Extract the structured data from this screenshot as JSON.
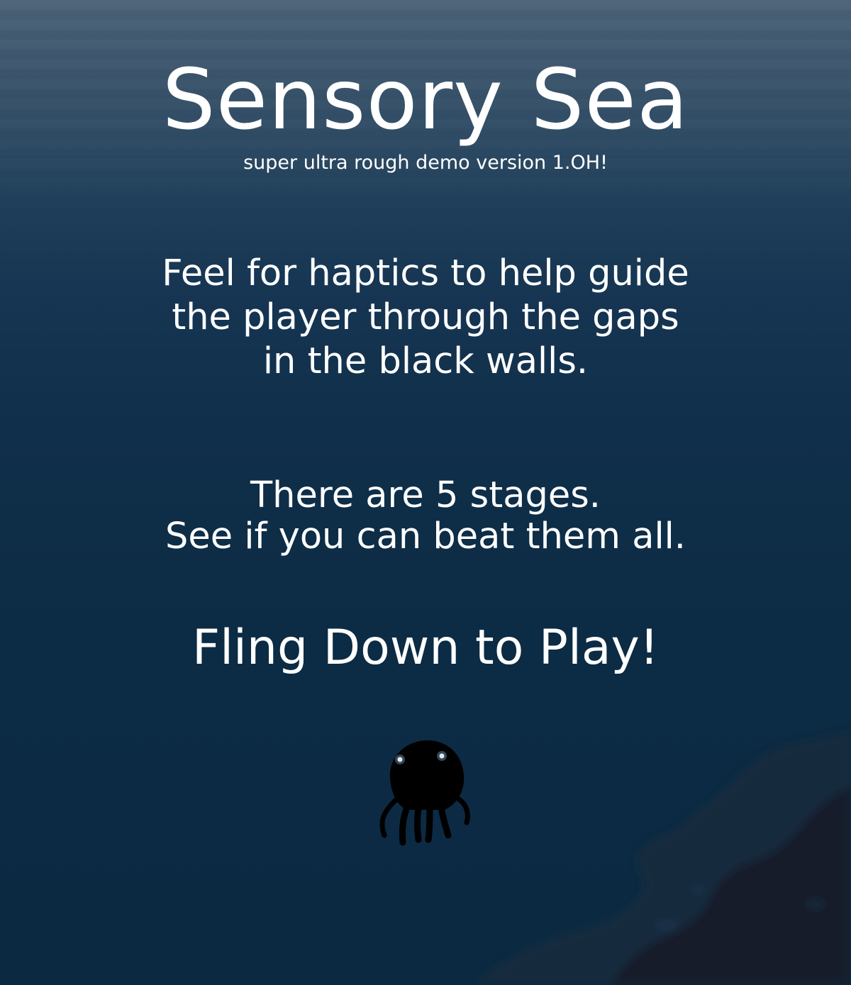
{
  "game": {
    "title": "Sensory Sea",
    "subtitle": "super ultra rough demo version 1.OH!",
    "instructions": [
      "Feel for haptics to help guide",
      "the player through the gaps",
      "in the black walls."
    ],
    "stages_info": [
      "There are 5 stages.",
      "See if you can beat them all."
    ],
    "play_prompt": "Fling Down to Play!",
    "stage_count": 5
  },
  "colors": {
    "sky_top": "#4a6176",
    "sea_deep": "#0b2a42",
    "text": "#ffffff",
    "terrain": "#13273a",
    "player": "#000000"
  },
  "icons": {
    "player": "octopus-player"
  }
}
